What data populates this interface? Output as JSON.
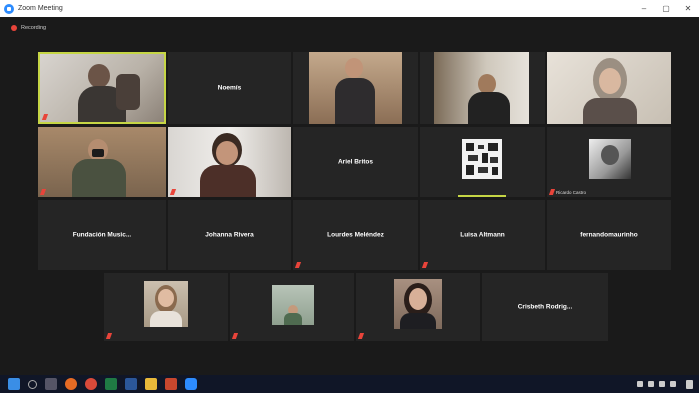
{
  "window": {
    "title": "Zoom Meeting",
    "controls": [
      "–",
      "▢",
      "✕"
    ]
  },
  "recording": {
    "label": "Recording"
  },
  "participants": [
    {
      "name": "",
      "video": true,
      "active": true,
      "muted": true
    },
    {
      "name": "Noemís",
      "video": false,
      "muted": false
    },
    {
      "name": "",
      "video": true,
      "muted": false
    },
    {
      "name": "",
      "video": true,
      "muted": false
    },
    {
      "name": "",
      "video": true,
      "muted": false
    },
    {
      "name": "",
      "video": true,
      "muted": true
    },
    {
      "name": "",
      "video": true,
      "muted": true
    },
    {
      "name": "Ariel Britos",
      "video": false,
      "muted": false
    },
    {
      "name": "",
      "video": true,
      "muted": false
    },
    {
      "name": "Ricardo Castro",
      "video": true,
      "muted": true
    },
    {
      "name": "Fundación Music...",
      "video": false,
      "muted": false
    },
    {
      "name": "Johanna Rivera",
      "video": false,
      "muted": false
    },
    {
      "name": "Lourdes Meléndez",
      "video": false,
      "muted": true
    },
    {
      "name": "Luisa Altmann",
      "video": false,
      "muted": true
    },
    {
      "name": "fernandomaurinho",
      "video": false,
      "muted": false
    },
    {
      "name": "",
      "video": true,
      "muted": true
    },
    {
      "name": "",
      "video": true,
      "muted": true
    },
    {
      "name": "",
      "video": true,
      "muted": true
    },
    {
      "name": "Crisbeth Rodrig...",
      "video": false,
      "muted": false
    }
  ],
  "taskbar": {
    "apps": [
      "windows-start",
      "search",
      "task-view",
      "firefox",
      "chrome",
      "excel",
      "word",
      "file-explorer",
      "powerpoint",
      "zoom"
    ],
    "clock": [
      "",
      ""
    ]
  }
}
